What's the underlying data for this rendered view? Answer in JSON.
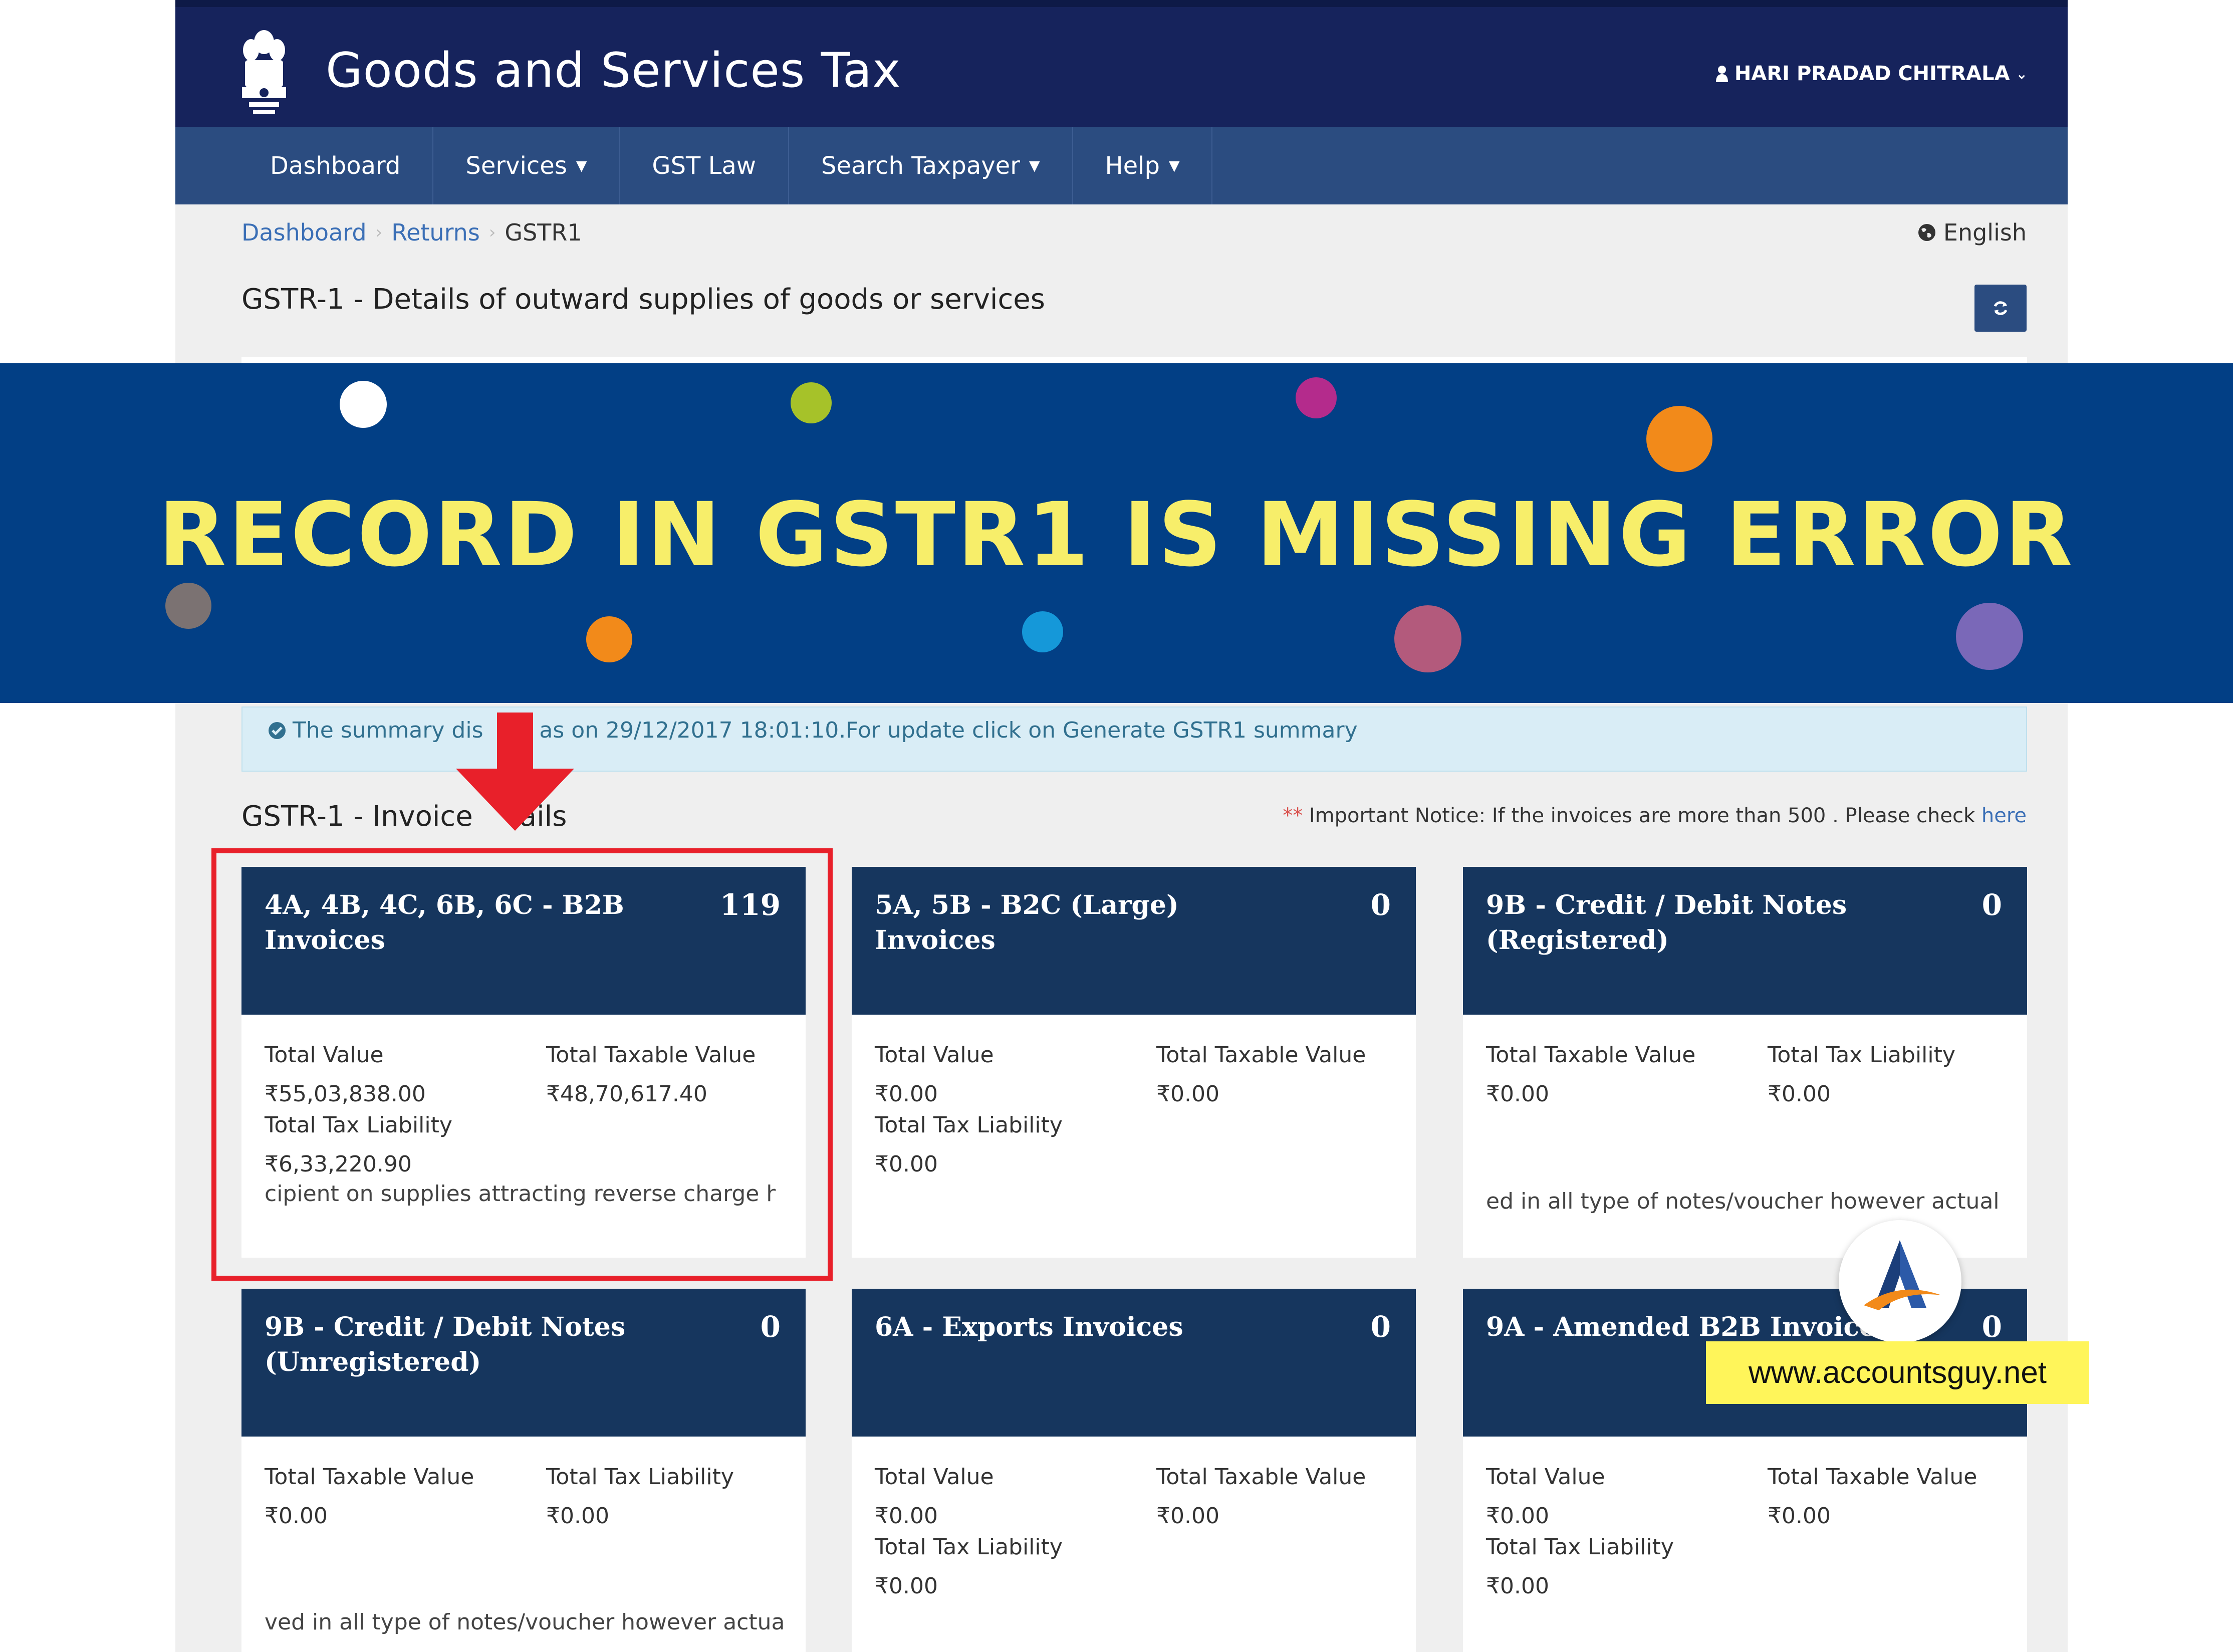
{
  "header": {
    "title": "Goods and Services Tax",
    "user_name": "HARI PRADAD CHITRALA"
  },
  "nav": {
    "items": [
      {
        "label": "Dashboard"
      },
      {
        "label": "Services"
      },
      {
        "label": "GST Law"
      },
      {
        "label": "Search Taxpayer"
      },
      {
        "label": "Help"
      }
    ]
  },
  "breadcrumb": {
    "items": [
      "Dashboard",
      "Returns",
      "GSTR1"
    ]
  },
  "language": "English",
  "page_heading": "GSTR-1 - Details of outward supplies of goods or services",
  "banner": {
    "text": "RECORD IN GSTR1 IS MISSING ERROR",
    "dot_colors": [
      "#ffffff",
      "#a6c229",
      "#b42b8c",
      "#f28a1a",
      "#7b7272",
      "#f28a1a",
      "#1598d9",
      "#b35a7c",
      "#7a68b8"
    ]
  },
  "notice": {
    "text": "The summary dis     d as on 29/12/2017 18:01:10.For update click on Generate GSTR1 summary"
  },
  "section": {
    "title": "GSTR-1 - Invoice    tails",
    "important_stars": "**",
    "important_text": "Important Notice: If the invoices are more than 500 . Please check ",
    "important_link": "here"
  },
  "cards": [
    {
      "title": "4A, 4B, 4C, 6B, 6C - B2B Invoices",
      "count": "119",
      "l1": "Total Value",
      "v1": "₹55,03,838.00",
      "l2": "Total Taxable Value",
      "v2": "₹48,70,617.40",
      "l3": "Total Tax Liability",
      "v3": "₹6,33,220.90",
      "note": "cipient on supplies attracting reverse charge ha"
    },
    {
      "title": "5A, 5B - B2C (Large) Invoices",
      "count": "0",
      "l1": "Total Value",
      "v1": "₹0.00",
      "l2": "Total Taxable Value",
      "v2": "₹0.00",
      "l3": "Total Tax Liability",
      "v3": "₹0.00",
      "note": ""
    },
    {
      "title": "9B - Credit / Debit Notes (Registered)",
      "count": "0",
      "l1": "Total Taxable Value",
      "v1": "₹0.00",
      "l2": "Total Tax Liability",
      "v2": "₹0.00",
      "l3": "",
      "v3": "",
      "note": "ed in all type of notes/voucher however actual"
    },
    {
      "title": "9B - Credit / Debit Notes (Unregistered)",
      "count": "0",
      "l1": "Total Taxable Value",
      "v1": "₹0.00",
      "l2": "Total Tax Liability",
      "v2": "₹0.00",
      "l3": "",
      "v3": "",
      "note": "ved in all type of notes/voucher however actua"
    },
    {
      "title": "6A - Exports Invoices",
      "count": "0",
      "l1": "Total Value",
      "v1": "₹0.00",
      "l2": "Total Taxable Value",
      "v2": "₹0.00",
      "l3": "Total Tax Liability",
      "v3": "₹0.00",
      "note": ""
    },
    {
      "title": "9A - Amended B2B Invoices",
      "count": "0",
      "l1": "Total Value",
      "v1": "₹0.00",
      "l2": "Total Taxable Value",
      "v2": "₹0.00",
      "l3": "Total Tax Liability",
      "v3": "₹0.00",
      "note": ""
    }
  ],
  "watermark": {
    "url": "www.accountsguy.net"
  },
  "colors": {
    "header_bg": "#16235c",
    "nav_bg": "#2b4c80",
    "banner_bg": "#023f85",
    "banner_text": "#f7ee6a",
    "card_head": "#16365e",
    "highlight": "#e8202a"
  }
}
